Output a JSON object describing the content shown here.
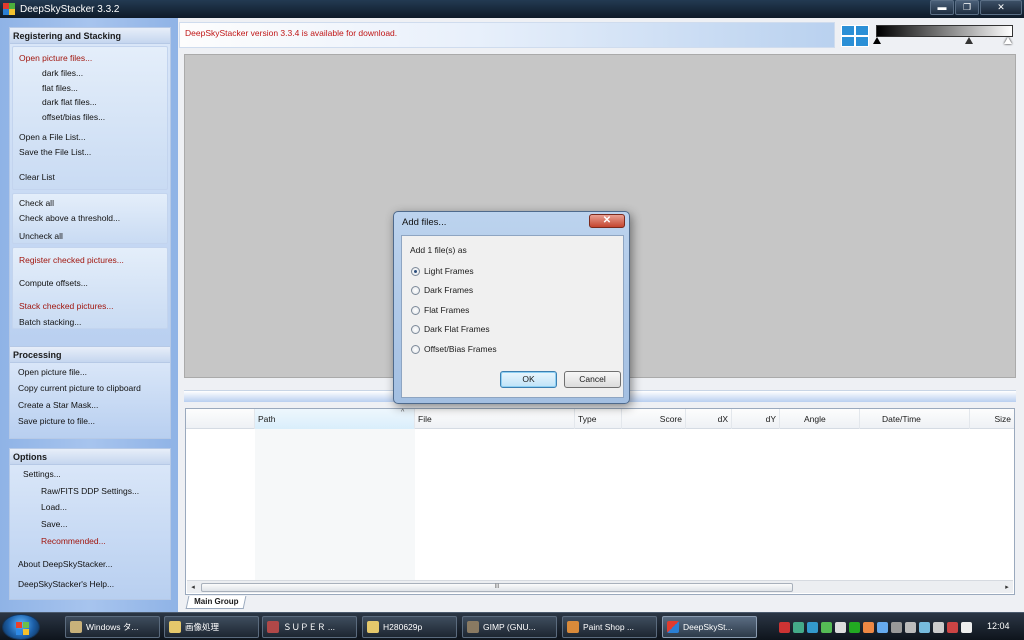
{
  "window": {
    "title": "DeepSkyStacker 3.3.2",
    "min_glyph": "▬",
    "max_glyph": "❐",
    "close_glyph": "✕"
  },
  "sidebar": {
    "registering": {
      "title": "Registering and Stacking",
      "open_picture_files": "Open picture files...",
      "dark_files": "dark files...",
      "flat_files": "flat files...",
      "dark_flat_files": "dark flat files...",
      "offset_bias_files": "offset/bias files...",
      "open_file_list": "Open a File List...",
      "save_file_list": "Save the File List...",
      "clear_list": "Clear List",
      "check_all": "Check all",
      "check_above_threshold": "Check above a threshold...",
      "uncheck_all": "Uncheck all",
      "register_checked": "Register checked pictures...",
      "compute_offsets": "Compute offsets...",
      "stack_checked": "Stack checked pictures...",
      "batch_stacking": "Batch stacking..."
    },
    "processing": {
      "title": "Processing",
      "open_picture_file": "Open picture file...",
      "copy_to_clipboard": "Copy current picture to clipboard",
      "create_star_mask": "Create a Star Mask...",
      "save_picture": "Save picture to file..."
    },
    "options": {
      "title": "Options",
      "settings": "Settings...",
      "raw_fits": "Raw/FITS DDP Settings...",
      "load": "Load...",
      "save": "Save...",
      "recommended": "Recommended...",
      "about": "About DeepSkyStacker...",
      "help": "DeepSkyStacker's Help..."
    }
  },
  "banner": {
    "message": "DeepSkyStacker version 3.3.4 is available for download."
  },
  "file_list": {
    "columns": [
      "Path",
      "File",
      "Type",
      "Score",
      "dX",
      "dY",
      "Angle",
      "Date/Time",
      "Size"
    ],
    "sort_glyph": "^",
    "scroll_grip": "III",
    "scroll_left": "◂",
    "scroll_right": "▸",
    "tab": "Main Group"
  },
  "dialog": {
    "title": "Add files...",
    "close_glyph": "✕",
    "prompt": "Add 1 file(s) as",
    "options": [
      "Light Frames",
      "Dark Frames",
      "Flat Frames",
      "Dark Flat Frames",
      "Offset/Bias Frames"
    ],
    "selected": "Light Frames",
    "ok": "OK",
    "cancel": "Cancel"
  },
  "taskbar": {
    "tasks": [
      "Windows タ...",
      "画像処理",
      "ＳＵＰＥＲ ...",
      "H280629p",
      "GIMP (GNU...",
      "Paint Shop ...",
      "DeepSkySt..."
    ],
    "active_task": "DeepSkySt...",
    "clock": "12:04"
  },
  "colors": {
    "accent_red": "#c01616",
    "link_red": "#a1160e",
    "sidebar_blue": "#a7c4ee",
    "preview_gray": "#c6c6c6"
  }
}
